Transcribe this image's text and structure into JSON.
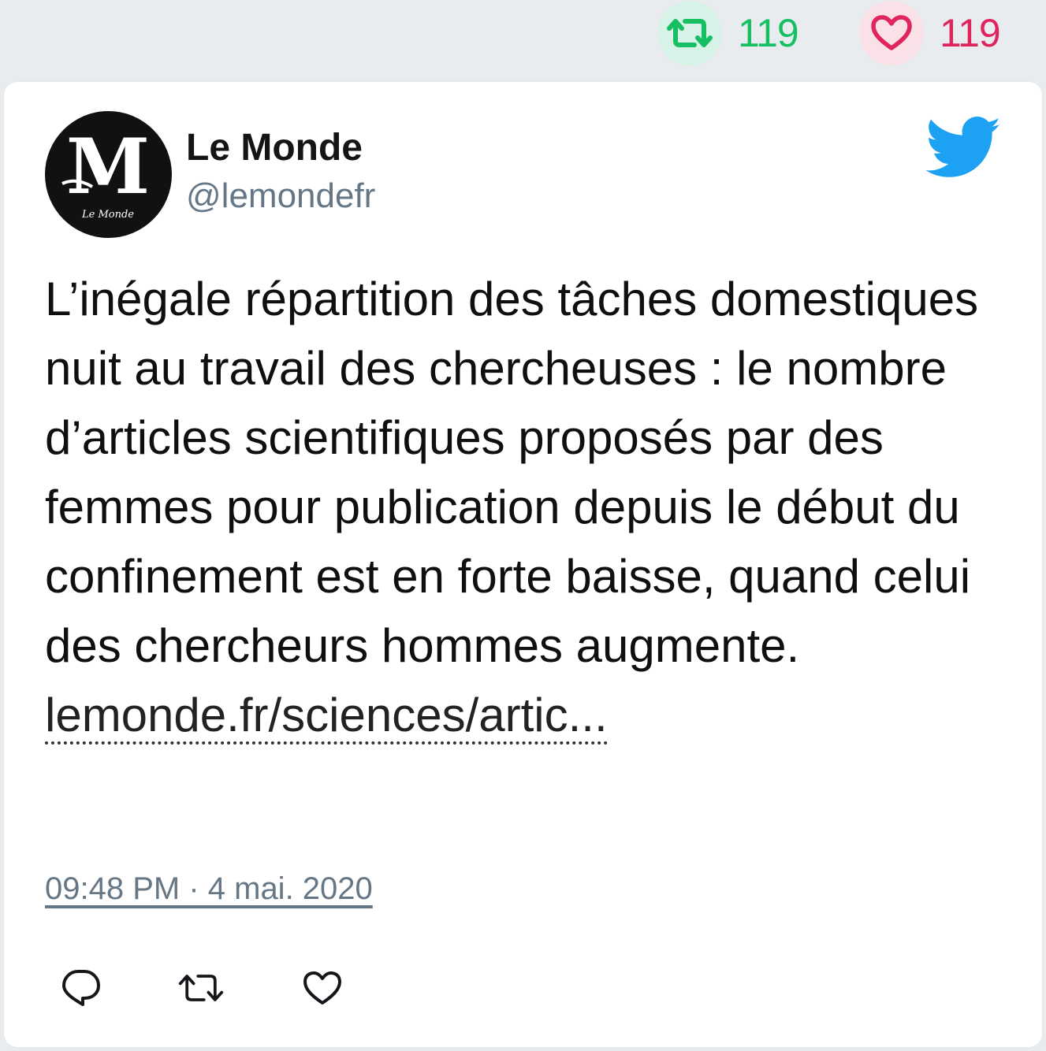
{
  "top_stats": {
    "retweet_count": "119",
    "like_count": "119",
    "retweet_icon": "retweet-icon",
    "like_icon": "heart-icon",
    "retweet_color": "#17bf63",
    "like_color": "#e0245e"
  },
  "tweet": {
    "author_name": "Le Monde",
    "handle": "@lemondefr",
    "avatar_logo": "Le Monde",
    "text_before_link": "L’inégale répartition des tâches domestiques nuit au travail des chercheuses : le nombre d’articles scientifiques proposés par des femmes pour publication depuis le début du confinement est en forte baisse, quand celui des chercheurs hommes augmente. ",
    "link_text": "lemonde.fr/sciences/artic...",
    "timestamp": "09:48 PM · 4 mai. 2020",
    "brand_icon": "twitter-bird-icon",
    "brand_color": "#1da1f2"
  },
  "actions": {
    "reply_icon": "reply-icon",
    "retweet_icon": "retweet-icon",
    "like_icon": "heart-icon"
  }
}
